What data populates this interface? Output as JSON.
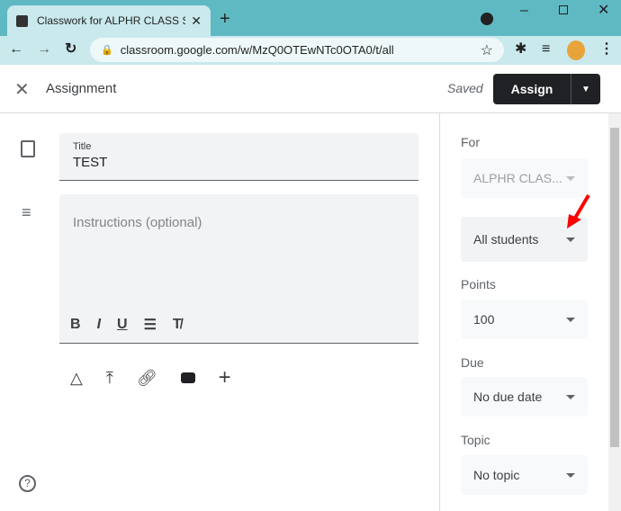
{
  "browser": {
    "tab_title": "Classwork for ALPHR CLASS SAMPLE",
    "url": "classroom.google.com/w/MzQ0OTEwNTc0OTA0/t/all"
  },
  "header": {
    "title": "Assignment",
    "status": "Saved",
    "assign_label": "Assign"
  },
  "form": {
    "title_label": "Title",
    "title_value": "TEST",
    "instructions_placeholder": "Instructions (optional)"
  },
  "sidebar": {
    "for_label": "For",
    "class_value": "ALPHR CLAS...",
    "students_value": "All students",
    "points_label": "Points",
    "points_value": "100",
    "due_label": "Due",
    "due_value": "No due date",
    "topic_label": "Topic",
    "topic_value": "No topic"
  },
  "colors": {
    "tabstrip": "#5fb9c3",
    "toolbar": "#c9e9ed",
    "assign_button": "#202124",
    "annotation_arrow": "#ff0000"
  }
}
